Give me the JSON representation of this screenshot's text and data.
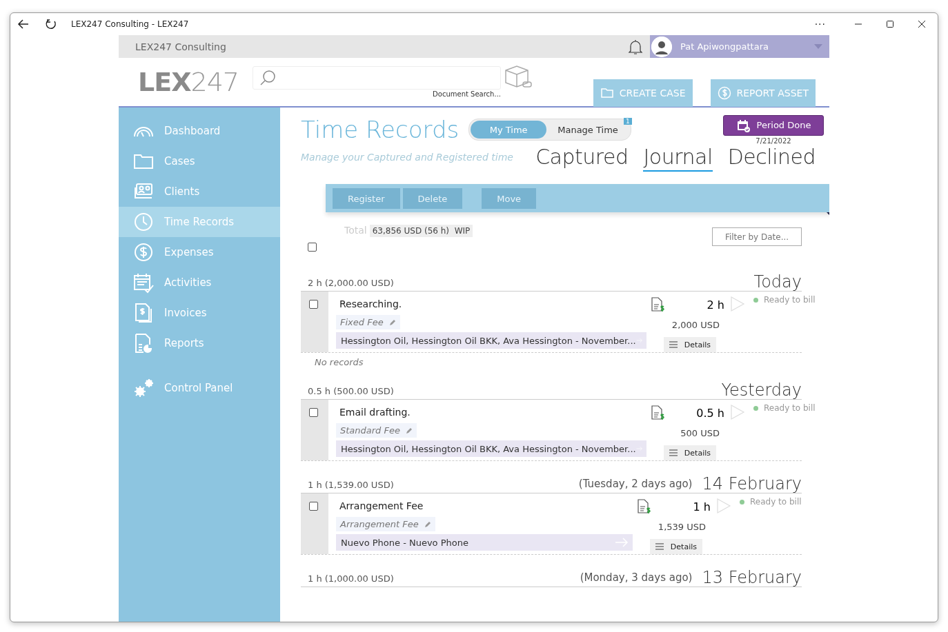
{
  "window": {
    "title": "LEX247 Consulting - LEX247",
    "menu": "···"
  },
  "topbar": {
    "company": "LEX247 Consulting",
    "user": "Pat Apiwongpattara"
  },
  "header": {
    "logo_strong": "LEX",
    "logo_light": "247",
    "search_caption": "Document Search...",
    "buttons": [
      "CREATE CASE",
      "REPORT ASSET"
    ]
  },
  "sidebar": {
    "items": [
      {
        "label": "Dashboard",
        "selected": false
      },
      {
        "label": "Cases",
        "selected": false
      },
      {
        "label": "Clients",
        "selected": false
      },
      {
        "label": "Time Records",
        "selected": true
      },
      {
        "label": "Expenses",
        "selected": false
      },
      {
        "label": "Activities",
        "selected": false
      },
      {
        "label": "Invoices",
        "selected": false
      },
      {
        "label": "Reports",
        "selected": false
      },
      {
        "label": "Control Panel",
        "selected": false
      }
    ]
  },
  "page": {
    "title": "Time Records",
    "toggle": [
      {
        "label": "My Time",
        "selected": true
      },
      {
        "label": "Manage Time",
        "selected": false,
        "badge": "1"
      }
    ],
    "period_button": "Period Done",
    "period_date": "7/21/2022",
    "subtitle": "Manage your Captured and Registered time",
    "tabs": [
      {
        "label": "Captured",
        "selected": false
      },
      {
        "label": "Journal",
        "selected": true
      },
      {
        "label": "Declined",
        "selected": false
      }
    ],
    "actions": [
      {
        "label": "Register",
        "disabled": true
      },
      {
        "label": "Delete",
        "disabled": true
      },
      {
        "label": "Move",
        "disabled": true
      }
    ],
    "total_label": "Total",
    "total_value": "63,856 USD (56 h)  WIP",
    "filter_button": "Filter by Date...",
    "select_all_checked": false
  },
  "groups": [
    {
      "summary": "2 h (2,000.00 USD)",
      "day": "Today",
      "note": "No records",
      "entries": [
        {
          "checked": false,
          "description": "Researching.",
          "fee": "Fixed Fee",
          "matter": "Hessington Oil, Hessington Oil BKK, Ava Hessington - November...",
          "hours": "2 h",
          "amount": "2,000 USD",
          "status": "Ready to bill",
          "details": "Details"
        }
      ]
    },
    {
      "summary": "0.5 h (500.00 USD)",
      "day": "Yesterday",
      "entries": [
        {
          "checked": false,
          "description": "Email drafting.",
          "fee": "Standard Fee",
          "matter": "Hessington Oil, Hessington Oil BKK, Ava Hessington - November...",
          "hours": "0.5 h",
          "amount": "500 USD",
          "status": "Ready to bill",
          "details": "Details"
        }
      ]
    },
    {
      "summary": "1 h (1,539.00 USD)",
      "relative": "(Tuesday, 2 days ago)",
      "day": "14 February",
      "entries": [
        {
          "checked": false,
          "description": "Arrangement Fee",
          "fee": "Arrangement Fee",
          "matter": "Nuevo Phone - Nuevo Phone",
          "hours": "1 h",
          "amount": "1,539 USD",
          "status": "Ready to bill",
          "details": "Details"
        }
      ]
    },
    {
      "summary": "1 h (1,000.00 USD)",
      "relative": "(Monday, 3 days ago)",
      "day": "13 February"
    }
  ]
}
